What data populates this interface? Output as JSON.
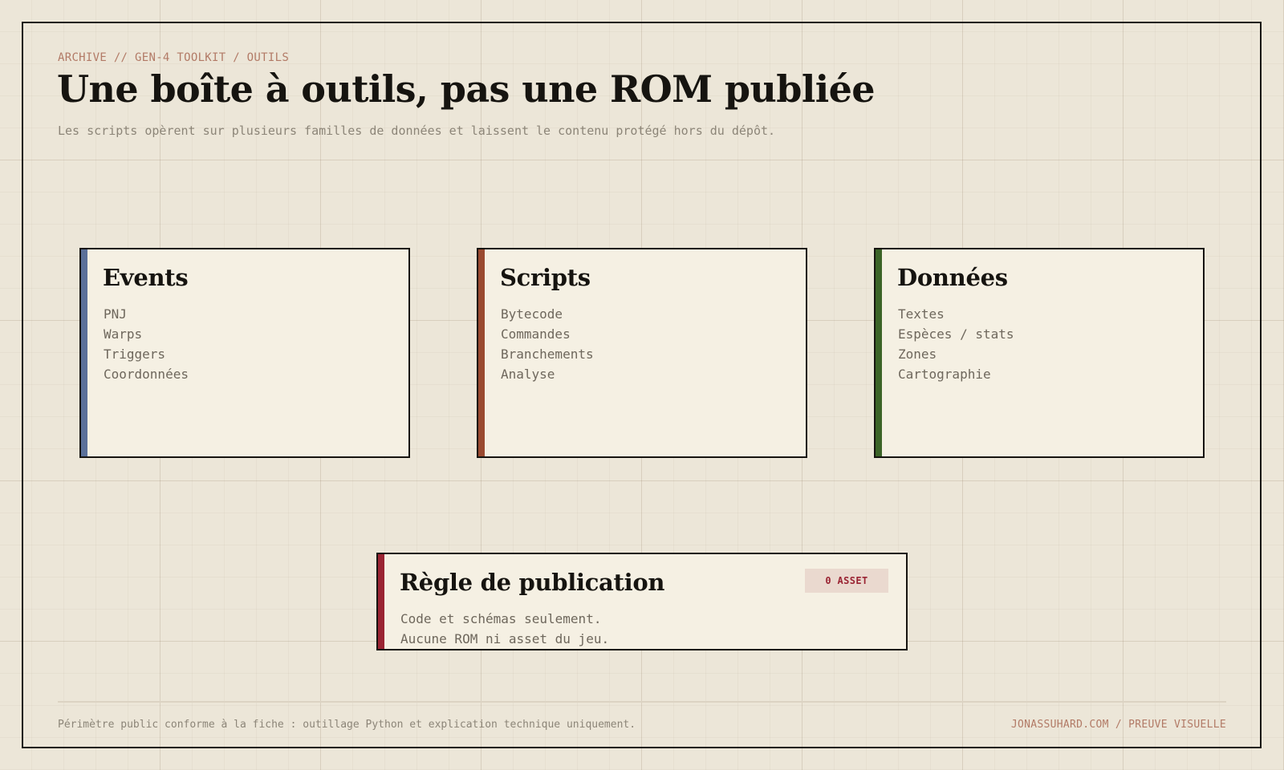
{
  "header": {
    "breadcrumb": "ARCHIVE // GEN-4 TOOLKIT / OUTILS",
    "title": "Une boîte à outils, pas une ROM publiée",
    "subtitle": "Les scripts opèrent sur plusieurs familles de données et laissent le contenu protégé hors du dépôt."
  },
  "cards": [
    {
      "title": "Events",
      "accent_color": "#5a7099",
      "items": [
        "PNJ",
        "Warps",
        "Triggers",
        "Coordonnées"
      ]
    },
    {
      "title": "Scripts",
      "accent_color": "#9a4a30",
      "items": [
        "Bytecode",
        "Commandes",
        "Branchements",
        "Analyse"
      ]
    },
    {
      "title": "Données",
      "accent_color": "#3c6428",
      "items": [
        "Textes",
        "Espèces / stats",
        "Zones",
        "Cartographie"
      ]
    }
  ],
  "rule": {
    "title": "Règle de publication",
    "accent_color": "#9a2433",
    "badge": "0 ASSET",
    "lines": [
      "Code et schémas seulement.",
      "Aucune ROM ni asset du jeu."
    ]
  },
  "footer": {
    "left": "Périmètre public conforme à la fiche : outillage Python et explication technique uniquement.",
    "right": "JONASSUHARD.COM / PREUVE VISUELLE"
  },
  "colors": {
    "background": "#ece6d8",
    "card_background": "#f5f0e3",
    "ink": "#161410",
    "muted_text": "#8c8578",
    "accent_text": "#b27a66"
  }
}
